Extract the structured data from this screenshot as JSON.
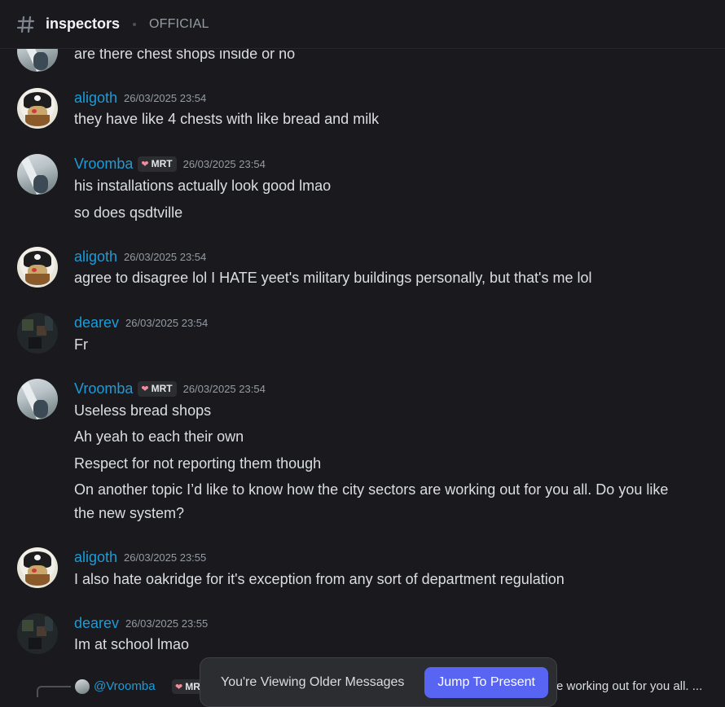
{
  "header": {
    "channel_name": "inspectors",
    "channel_topic": "OFFICIAL"
  },
  "top_clip": {
    "text": "are there chest shops inside or no"
  },
  "messages": [
    {
      "author": "aligoth",
      "timestamp": "26/03/2025 23:54",
      "lines": [
        "they have like 4 chests with like bread and milk"
      ]
    },
    {
      "author": "Vroomba",
      "badge": "MRT",
      "timestamp": "26/03/2025 23:54",
      "lines": [
        "his installations actually look good lmao",
        "so does qsdtville"
      ]
    },
    {
      "author": "aligoth",
      "timestamp": "26/03/2025 23:54",
      "lines": [
        "agree to disagree lol I HATE yeet's military buildings personally, but that's me lol"
      ]
    },
    {
      "author": "dearev",
      "timestamp": "26/03/2025 23:54",
      "lines": [
        "Fr"
      ]
    },
    {
      "author": "Vroomba",
      "badge": "MRT",
      "timestamp": "26/03/2025 23:54",
      "lines": [
        "Useless bread shops",
        "Ah yeah to each their own",
        "Respect for not reporting them though",
        "On another topic I’d like to know how the city sectors are working out for you all. Do you like",
        "the new system?"
      ]
    },
    {
      "author": "aligoth",
      "timestamp": "26/03/2025 23:55",
      "lines": [
        "I also hate oakridge for it's exception from any sort of department regulation"
      ]
    },
    {
      "author": "dearev",
      "timestamp": "26/03/2025 23:55",
      "lines": [
        "Im at school lmao"
      ]
    }
  ],
  "reply_preview": {
    "name": "@Vroomba",
    "badge": "MRT",
    "tail": "e working out for you all. ..."
  },
  "jump_bar": {
    "text": "You're Viewing Older Messages",
    "button": "Jump To Present"
  },
  "colors": {
    "username": "#1e9bd7",
    "accent": "#5865f2",
    "background": "#1a1a1e"
  }
}
